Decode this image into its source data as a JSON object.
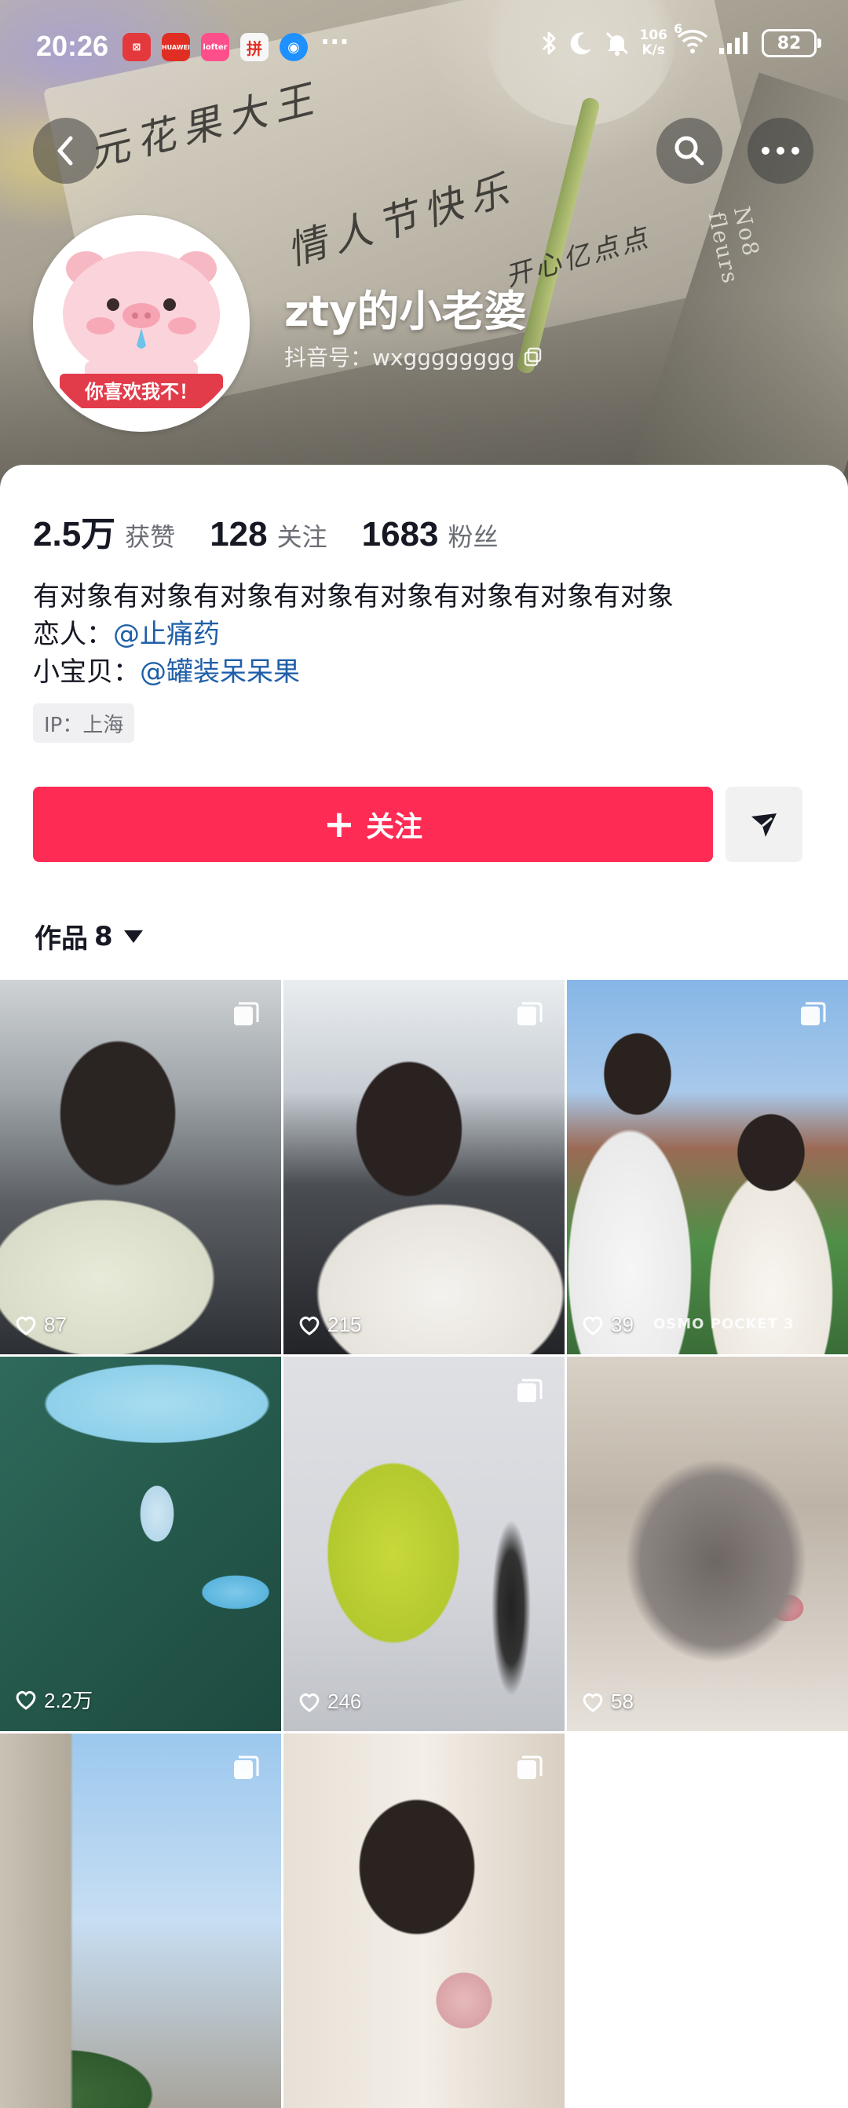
{
  "status_bar": {
    "time": "20:26",
    "app_icons": [
      {
        "icon": "xiaohongshu-app-icon",
        "glyph": "⊠"
      },
      {
        "icon": "huawei-mall-app-icon",
        "glyph": "HUAWEI"
      },
      {
        "icon": "lofter-app-icon",
        "glyph": "lofter"
      },
      {
        "icon": "pinduoduo-app-icon",
        "glyph": "拼"
      },
      {
        "icon": "chat-app-icon",
        "glyph": "◉"
      }
    ],
    "more": "···",
    "net_speed_value": "106",
    "net_speed_unit": "K/s",
    "wifi_label": "6",
    "battery": "82"
  },
  "header": {
    "handwriting_line1": "元花果大王",
    "handwriting_line2": "情人节快乐",
    "handwriting_line3": "开心亿点点",
    "spine_text": "No8 fleurs"
  },
  "profile": {
    "nickname": "zty的小老婆",
    "douyin_id": "抖音号：wxgggggggg",
    "avatar_caption": "你喜欢我不！"
  },
  "stats": [
    {
      "value": "2.5万",
      "label": "获赞"
    },
    {
      "value": "128",
      "label": "关注"
    },
    {
      "value": "1683",
      "label": "粉丝"
    }
  ],
  "bio": {
    "line1": "有对象有对象有对象有对象有对象有对象有对象有对象",
    "lover_prefix": "恋人：",
    "lover_mention": "@止痛药",
    "baby_prefix": "小宝贝：",
    "baby_mention": "@罐装呆呆果"
  },
  "ip_tag": "IP：上海",
  "actions": {
    "follow_plus": "+",
    "follow_label": "关注"
  },
  "works": {
    "tab_label": "作品",
    "count": "8"
  },
  "videos": [
    {
      "likes": "87",
      "multi": true
    },
    {
      "likes": "215",
      "multi": true
    },
    {
      "likes": "39",
      "multi": true,
      "watermark": "OSMO POCKET 3"
    },
    {
      "likes": "2.2万",
      "multi": false
    },
    {
      "likes": "246",
      "multi": true
    },
    {
      "likes": "58",
      "multi": false
    },
    {
      "likes": "",
      "multi": true
    },
    {
      "likes": "",
      "multi": true
    }
  ],
  "colors": {
    "accent": "#fe2c55",
    "mention": "#1f5fa8",
    "text_primary": "#161823",
    "text_secondary": "#6b6d75"
  }
}
